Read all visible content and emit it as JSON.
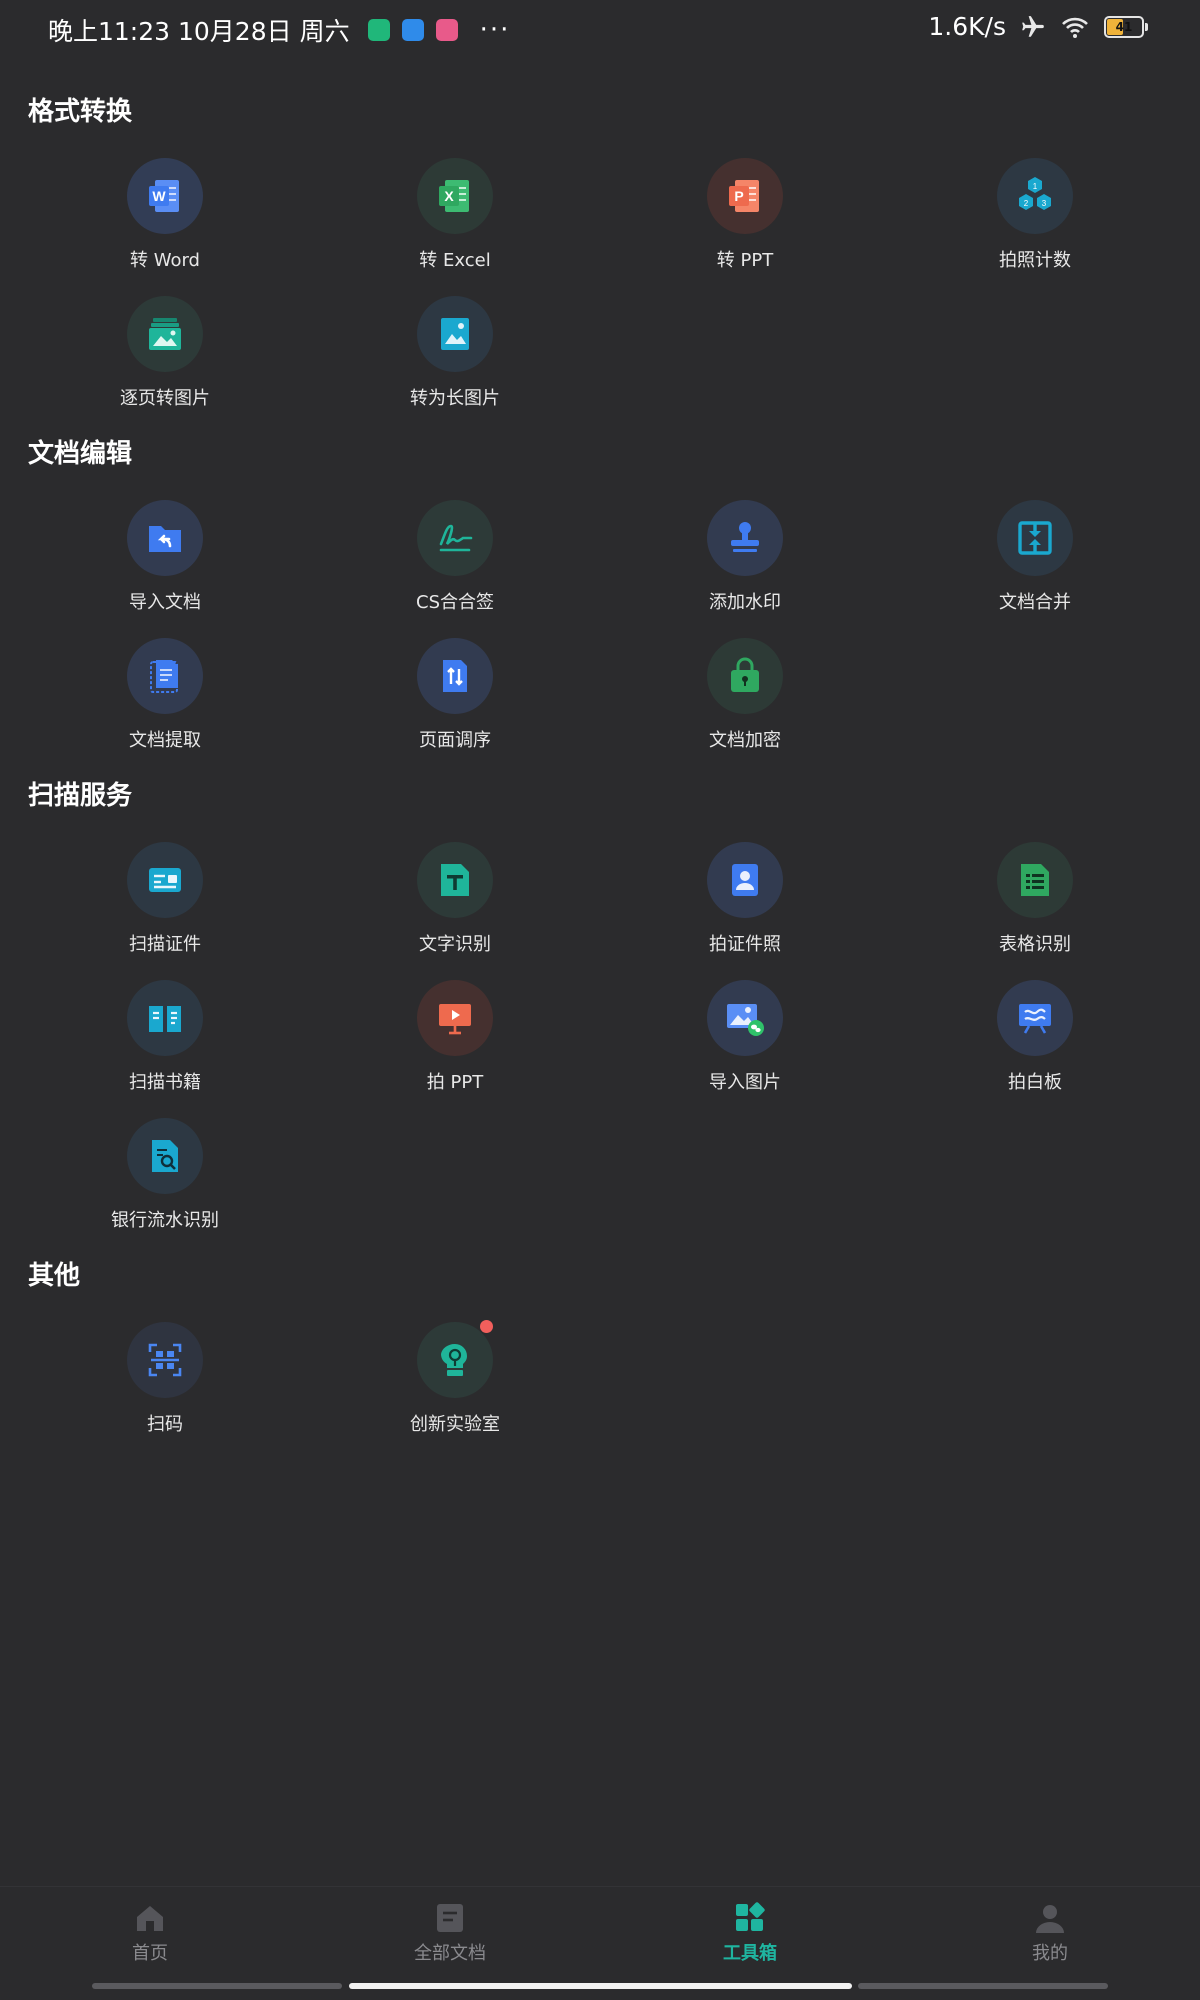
{
  "status_bar": {
    "time": "晚上11:23 10月28日 周六",
    "dots": "···",
    "net_speed": "1.6K/s",
    "battery": "41"
  },
  "sections": [
    {
      "title": "格式转换",
      "tools": [
        {
          "label": "转 Word",
          "icon": "word-icon",
          "bg": "#323d55"
        },
        {
          "label": "转 Excel",
          "icon": "excel-icon",
          "bg": "#2d3a36"
        },
        {
          "label": "转 PPT",
          "icon": "ppt-icon",
          "bg": "#45302f"
        },
        {
          "label": "拍照计数",
          "icon": "count-icon",
          "bg": "#2d3843"
        },
        {
          "label": "逐页转图片",
          "icon": "image-pages-icon",
          "bg": "#2d3a38"
        },
        {
          "label": "转为长图片",
          "icon": "long-image-icon",
          "bg": "#2d3843"
        }
      ]
    },
    {
      "title": "文档编辑",
      "tools": [
        {
          "label": "导入文档",
          "icon": "import-doc-icon",
          "bg": "#323b50"
        },
        {
          "label": "CS合合签",
          "icon": "signature-icon",
          "bg": "#2d3a38"
        },
        {
          "label": "添加水印",
          "icon": "stamp-icon",
          "bg": "#323b50"
        },
        {
          "label": "文档合并",
          "icon": "merge-icon",
          "bg": "#2d3843"
        },
        {
          "label": "文档提取",
          "icon": "extract-icon",
          "bg": "#323b50"
        },
        {
          "label": "页面调序",
          "icon": "reorder-icon",
          "bg": "#323b50"
        },
        {
          "label": "文档加密",
          "icon": "lock-icon",
          "bg": "#2d3a36"
        }
      ]
    },
    {
      "title": "扫描服务",
      "tools": [
        {
          "label": "扫描证件",
          "icon": "id-card-icon",
          "bg": "#2d3843"
        },
        {
          "label": "文字识别",
          "icon": "text-ocr-icon",
          "bg": "#2d3a38"
        },
        {
          "label": "拍证件照",
          "icon": "id-photo-icon",
          "bg": "#323b50"
        },
        {
          "label": "表格识别",
          "icon": "table-ocr-icon",
          "bg": "#2d3a36"
        },
        {
          "label": "扫描书籍",
          "icon": "book-icon",
          "bg": "#2d3843"
        },
        {
          "label": "拍 PPT",
          "icon": "presentation-icon",
          "bg": "#45302f"
        },
        {
          "label": "导入图片",
          "icon": "import-image-icon",
          "bg": "#323b50"
        },
        {
          "label": "拍白板",
          "icon": "whiteboard-icon",
          "bg": "#323b50"
        },
        {
          "label": "银行流水识别",
          "icon": "bank-statement-icon",
          "bg": "#2d3843"
        }
      ]
    },
    {
      "title": "其他",
      "tools": [
        {
          "label": "扫码",
          "icon": "qr-scan-icon",
          "bg": "#2f3440"
        },
        {
          "label": "创新实验室",
          "icon": "lab-icon",
          "bg": "#2d3a38",
          "badge": true
        }
      ]
    }
  ],
  "bottom_nav": [
    {
      "label": "首页",
      "icon": "home-icon",
      "active": false
    },
    {
      "label": "全部文档",
      "icon": "documents-icon",
      "active": false
    },
    {
      "label": "工具箱",
      "icon": "toolbox-icon",
      "active": true
    },
    {
      "label": "我的",
      "icon": "profile-icon",
      "active": false
    }
  ],
  "colors": {
    "background": "#2b2b2d",
    "accent": "#1fb5a0",
    "word": "#3f7bf0",
    "excel": "#2fa860",
    "ppt": "#ee6a4e",
    "teal": "#1aa8cf",
    "green": "#1fb59a"
  }
}
